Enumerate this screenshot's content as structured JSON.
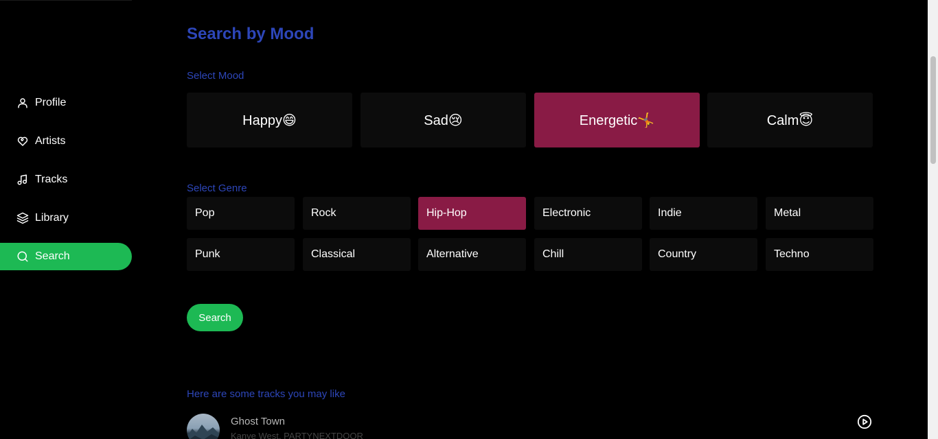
{
  "sidebar": {
    "items": [
      {
        "label": "Profile",
        "icon": "user-icon"
      },
      {
        "label": "Artists",
        "icon": "heart-icon"
      },
      {
        "label": "Tracks",
        "icon": "music-note-icon"
      },
      {
        "label": "Library",
        "icon": "layers-icon"
      },
      {
        "label": "Search",
        "icon": "search-icon",
        "active": true
      }
    ]
  },
  "main": {
    "title": "Search by Mood",
    "mood_label": "Select Mood",
    "moods": [
      {
        "label": "Happy😄",
        "selected": false
      },
      {
        "label": "Sad😢",
        "selected": false
      },
      {
        "label": "Energetic🤸",
        "selected": true
      },
      {
        "label": "Calm😇",
        "selected": false
      }
    ],
    "genre_label": "Select Genre",
    "genres": [
      {
        "label": "Pop",
        "selected": false
      },
      {
        "label": "Rock",
        "selected": false
      },
      {
        "label": "Hip-Hop",
        "selected": true
      },
      {
        "label": "Electronic",
        "selected": false
      },
      {
        "label": "Indie",
        "selected": false
      },
      {
        "label": "Metal",
        "selected": false
      },
      {
        "label": "Punk",
        "selected": false
      },
      {
        "label": "Classical",
        "selected": false
      },
      {
        "label": "Alternative",
        "selected": false
      },
      {
        "label": "Chill",
        "selected": false
      },
      {
        "label": "Country",
        "selected": false
      },
      {
        "label": "Techno",
        "selected": false
      }
    ],
    "search_button": "Search",
    "recommendations_label": "Here are some tracks you may like",
    "tracks": [
      {
        "title": "Ghost Town",
        "artist": "Kanye West, PARTYNEXTDOOR"
      }
    ]
  },
  "colors": {
    "accent_green": "#1db954",
    "selected_magenta": "#891b45",
    "label_blue": "#2d46b9",
    "tile_bg": "#0c0c0c"
  }
}
